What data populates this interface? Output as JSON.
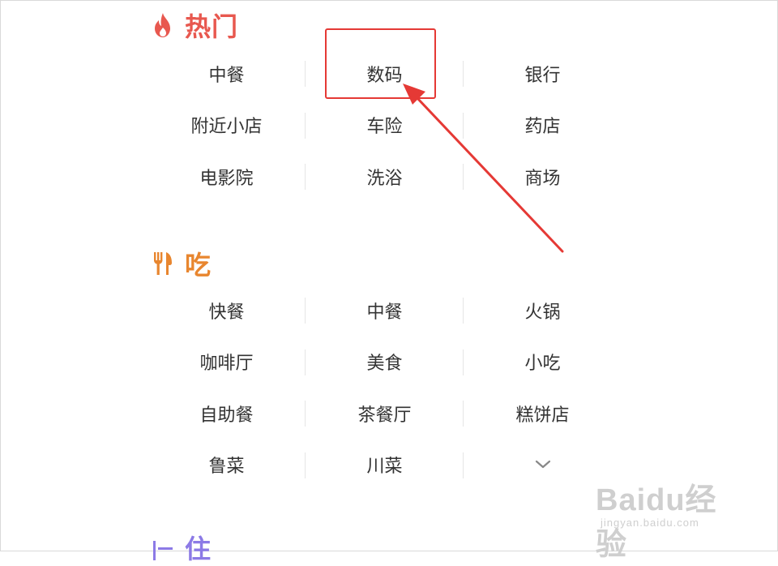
{
  "sections": [
    {
      "title": "热门",
      "icon": "flame-icon",
      "color": "#e8584f",
      "items": [
        [
          "中餐",
          "数码",
          "银行"
        ],
        [
          "附近小店",
          "车险",
          "药店"
        ],
        [
          "电影院",
          "洗浴",
          "商场"
        ]
      ]
    },
    {
      "title": "吃",
      "icon": "fork-knife-icon",
      "color": "#e8862f",
      "items": [
        [
          "快餐",
          "中餐",
          "火锅"
        ],
        [
          "咖啡厅",
          "美食",
          "小吃"
        ],
        [
          "自助餐",
          "茶餐厅",
          "糕饼店"
        ],
        [
          "鲁菜",
          "川菜",
          ""
        ]
      ],
      "expand_icon": "chevron-down-icon"
    },
    {
      "title": "住",
      "icon": "bed-icon",
      "color": "#8c7ae6"
    }
  ],
  "annotation": {
    "color": "#e53935",
    "target": "数码"
  },
  "watermark": {
    "logo": "Baidu经验",
    "url": "jingyan.baidu.com"
  }
}
